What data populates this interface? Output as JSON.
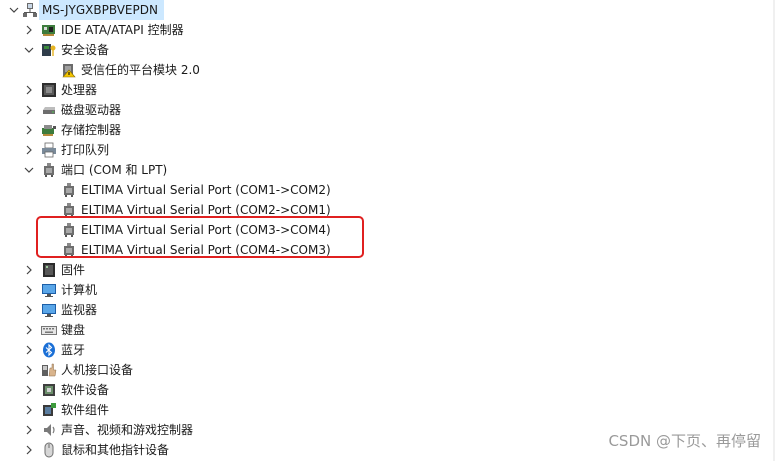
{
  "tree": {
    "root": {
      "label": "MS-JYGXBPBVEPDN",
      "icon": "computer-network-icon",
      "expanded": true
    },
    "items": [
      {
        "id": "ide",
        "label": "IDE ATA/ATAPI 控制器",
        "icon": "ide-controller-icon",
        "expanded": false
      },
      {
        "id": "security",
        "label": "安全设备",
        "icon": "security-key-icon",
        "expanded": true,
        "children": [
          {
            "id": "tpm",
            "label": "受信任的平台模块 2.0",
            "icon": "warning-chip-icon"
          }
        ]
      },
      {
        "id": "cpu",
        "label": "处理器",
        "icon": "processor-icon",
        "expanded": false
      },
      {
        "id": "disk",
        "label": "磁盘驱动器",
        "icon": "disk-drive-icon",
        "expanded": false
      },
      {
        "id": "storage",
        "label": "存储控制器",
        "icon": "storage-controller-icon",
        "expanded": false
      },
      {
        "id": "printq",
        "label": "打印队列",
        "icon": "printer-icon",
        "expanded": false
      },
      {
        "id": "ports",
        "label": "端口 (COM 和 LPT)",
        "icon": "port-icon",
        "expanded": true,
        "children": [
          {
            "id": "com1",
            "label": "ELTIMA Virtual Serial Port (COM1->COM2)",
            "icon": "serial-port-icon"
          },
          {
            "id": "com2",
            "label": "ELTIMA Virtual Serial Port (COM2->COM1)",
            "icon": "serial-port-icon"
          },
          {
            "id": "com3",
            "label": "ELTIMA Virtual Serial Port (COM3->COM4)",
            "icon": "serial-port-icon"
          },
          {
            "id": "com4",
            "label": "ELTIMA Virtual Serial Port (COM4->COM3)",
            "icon": "serial-port-icon"
          }
        ]
      },
      {
        "id": "firmware",
        "label": "固件",
        "icon": "firmware-icon",
        "expanded": false
      },
      {
        "id": "computer",
        "label": "计算机",
        "icon": "monitor-icon",
        "expanded": false
      },
      {
        "id": "monitors",
        "label": "监视器",
        "icon": "monitor-icon",
        "expanded": false
      },
      {
        "id": "keyboard",
        "label": "键盘",
        "icon": "keyboard-icon",
        "expanded": false
      },
      {
        "id": "bluetooth",
        "label": "蓝牙",
        "icon": "bluetooth-icon",
        "expanded": false
      },
      {
        "id": "hid",
        "label": "人机接口设备",
        "icon": "hid-icon",
        "expanded": false
      },
      {
        "id": "swdev",
        "label": "软件设备",
        "icon": "software-device-icon",
        "expanded": false
      },
      {
        "id": "swcomp",
        "label": "软件组件",
        "icon": "software-component-icon",
        "expanded": false
      },
      {
        "id": "audio",
        "label": "声音、视频和游戏控制器",
        "icon": "speaker-icon",
        "expanded": false
      },
      {
        "id": "mouse",
        "label": "鼠标和其他指针设备",
        "icon": "mouse-icon",
        "expanded": false
      }
    ]
  },
  "highlight": {
    "color": "#e02020"
  },
  "watermark": "CSDN @下页、再停留",
  "colors": {
    "selection": "#cce8ff",
    "text": "#1a1a1a"
  }
}
